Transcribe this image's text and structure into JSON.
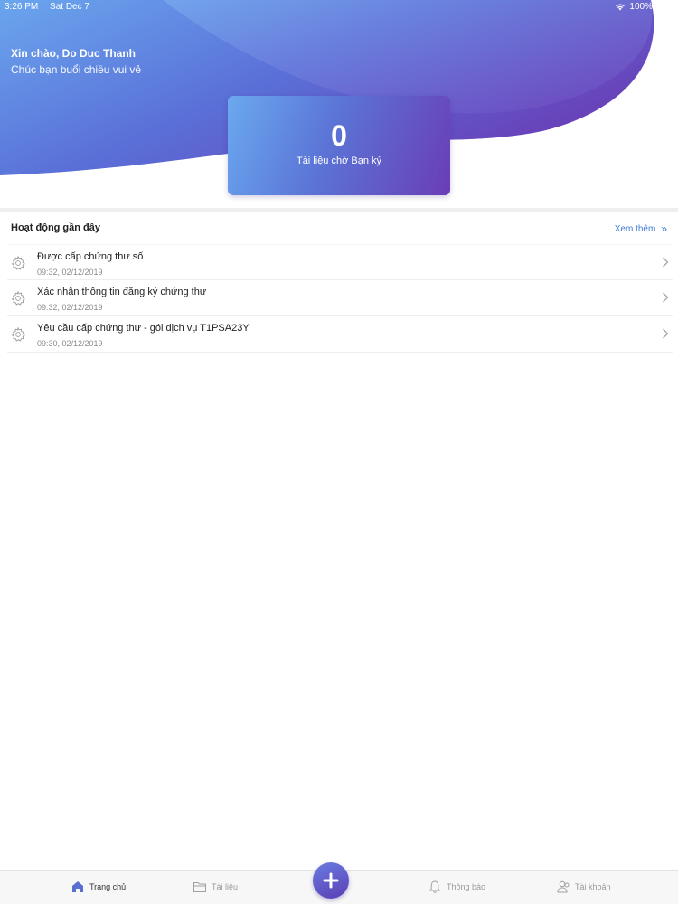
{
  "status_bar": {
    "time": "3:26 PM",
    "date": "Sat Dec 7",
    "battery": "100%"
  },
  "greeting": {
    "name_line": "Xin chào, Do Duc Thanh",
    "subtitle": "Chúc bạn buổi chiều vui vẻ"
  },
  "pending_card": {
    "count": "0",
    "label": "Tài liệu chờ Bạn ký"
  },
  "recent": {
    "title": "Hoạt động gần đây",
    "see_more": "Xem thêm",
    "items": [
      {
        "title": "Được cấp chứng thư số",
        "time": "09:32, 02/12/2019",
        "icon": "gear-icon"
      },
      {
        "title": "Xác nhận thông tin đăng ký chứng thư",
        "time": "09:32, 02/12/2019",
        "icon": "gear-icon"
      },
      {
        "title": "Yêu cầu cấp chứng thư - gói dịch vụ T1PSA23Y",
        "time": "09:30, 02/12/2019",
        "icon": "gear-icon"
      }
    ]
  },
  "tab_bar": {
    "home": "Trang chủ",
    "documents": "Tài liệu",
    "notifications": "Thông báo",
    "account": "Tài khoản",
    "active": "home"
  },
  "colors": {
    "gradient_start": "#6aa9ef",
    "gradient_end": "#6a3db6",
    "link": "#3a7bd5"
  }
}
